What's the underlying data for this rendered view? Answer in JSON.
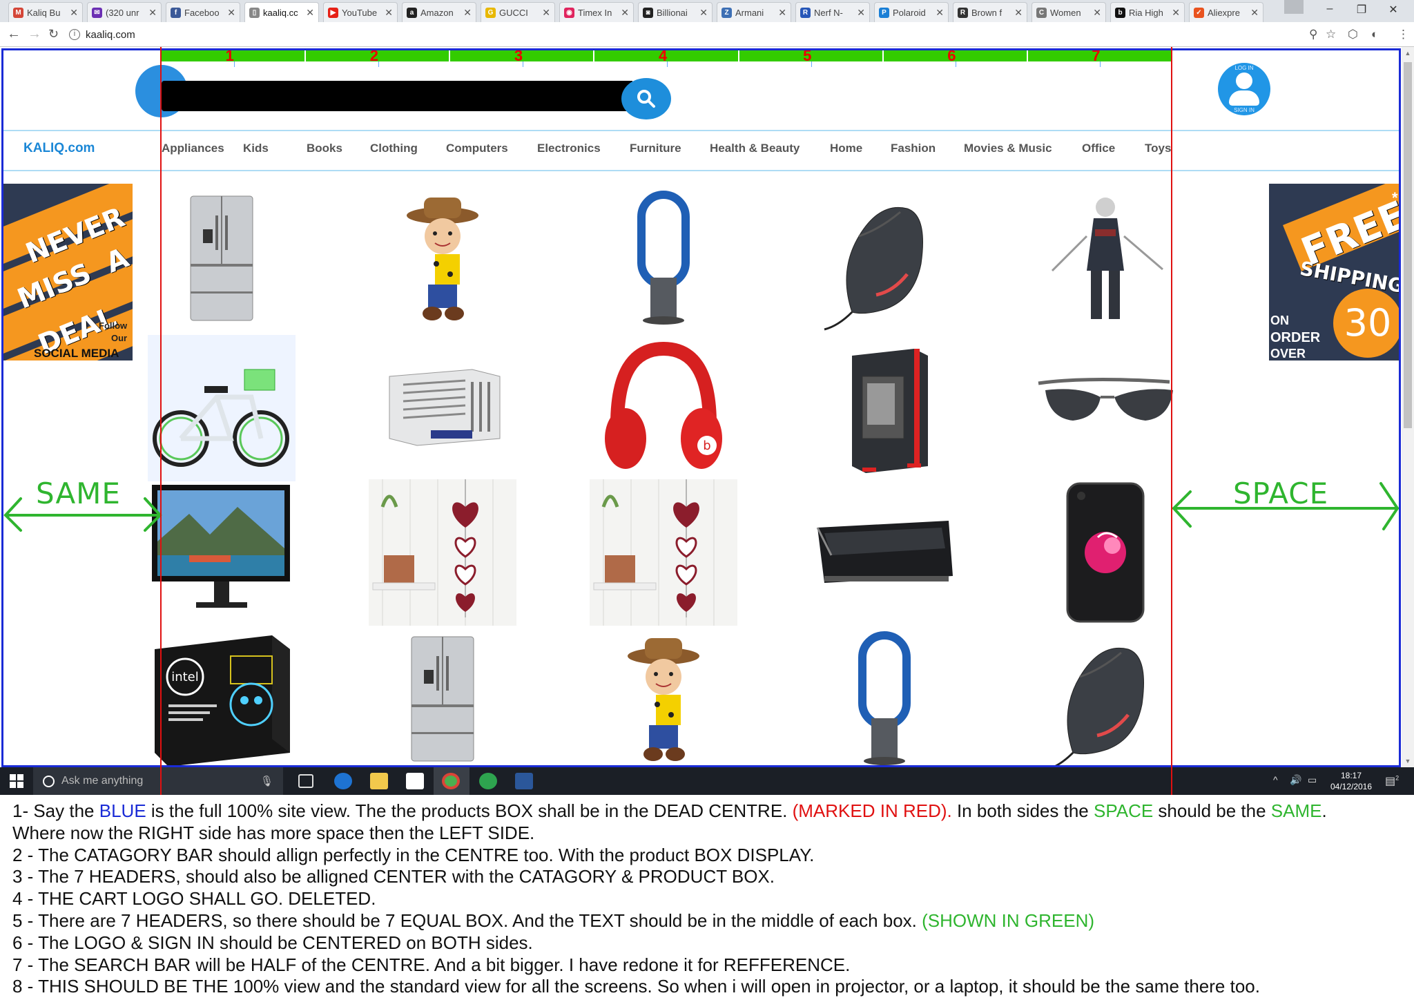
{
  "browser": {
    "tabs": [
      {
        "label": "Kaliq Bu",
        "icon": "gmail-icon",
        "color": "#d44638",
        "glyph": "M"
      },
      {
        "label": "(320 unr",
        "icon": "yahoo-mail-icon",
        "color": "#6b2fb3",
        "glyph": "✉"
      },
      {
        "label": "Faceboo",
        "icon": "facebook-icon",
        "color": "#3b5998",
        "glyph": "f"
      },
      {
        "label": "kaaliq.cc",
        "icon": "page-icon",
        "color": "#888888",
        "glyph": "▯"
      },
      {
        "label": "YouTube",
        "icon": "youtube-icon",
        "color": "#e62117",
        "glyph": "▶"
      },
      {
        "label": "Amazon",
        "icon": "amazon-icon",
        "color": "#222222",
        "glyph": "a"
      },
      {
        "label": "GUCCI",
        "icon": "gucci-icon",
        "color": "#e8b800",
        "glyph": "G"
      },
      {
        "label": "Timex In",
        "icon": "timex-icon",
        "color": "#e0245e",
        "glyph": "◉"
      },
      {
        "label": "Billionai",
        "icon": "billionaire-icon",
        "color": "#222222",
        "glyph": "◙"
      },
      {
        "label": "Armani",
        "icon": "armani-icon",
        "color": "#3d6fb4",
        "glyph": "Z"
      },
      {
        "label": "Nerf N-",
        "icon": "nerf-icon",
        "color": "#2757b8",
        "glyph": "R"
      },
      {
        "label": "Polaroid",
        "icon": "polaroid-icon",
        "color": "#1a7fd6",
        "glyph": "P"
      },
      {
        "label": "Brown f",
        "icon": "brown-icon",
        "color": "#333333",
        "glyph": "R"
      },
      {
        "label": "Women",
        "icon": "women-icon",
        "color": "#777777",
        "glyph": "C"
      },
      {
        "label": "Ria High",
        "icon": "ria-icon",
        "color": "#111111",
        "glyph": "b"
      },
      {
        "label": "Aliexpre",
        "icon": "aliexpress-icon",
        "color": "#e9531f",
        "glyph": "✓"
      }
    ],
    "active_tab": 3,
    "address": "kaaliq.com"
  },
  "site": {
    "name": "KALIQ.com",
    "signin_top": "LOG IN",
    "signin_bottom": "SIGN IN",
    "headers": [
      "1",
      "2",
      "3",
      "4",
      "5",
      "6",
      "7"
    ],
    "categories": [
      "Appliances",
      "Kids",
      "Books",
      "Clothing",
      "Computers",
      "Electronics",
      "Furniture",
      "Health & Beauty",
      "Home",
      "Fashion",
      "Movies & Music",
      "Office",
      "Toys"
    ]
  },
  "banners": {
    "left": {
      "line1": "NEVER",
      "line2": "MISS",
      "line3": "A",
      "line4": "DEAL",
      "follow": "Follow",
      "our": "Our",
      "social": "SOCIAL MEDIA"
    },
    "right": {
      "line1": "FREE",
      "line2": "SHIPPING",
      "on": "ON",
      "order": "ORDER",
      "over": "OVER",
      "amount": "30",
      "star": "*"
    }
  },
  "guides": {
    "left": "SAME",
    "right": "SPACE"
  },
  "products": [
    [
      "fridge",
      "woody-toy",
      "dyson-fan",
      "vertical-mouse",
      "assassin-figure"
    ],
    [
      "kids-bike",
      "window-ac",
      "red-headphones",
      "pc-case",
      "sunglasses"
    ],
    [
      "monitor",
      "heart-decor",
      "heart-decor",
      "split-ac",
      "iphone"
    ],
    [
      "intel-board",
      "fridge",
      "woody-toy",
      "dyson-fan",
      "vertical-mouse"
    ]
  ],
  "taskbar": {
    "search_placeholder": "Ask me anything",
    "time": "18:17",
    "date": "04/12/2016",
    "notifications": "2"
  },
  "notes": {
    "n1_a": "1- Say the ",
    "n1_b": "BLUE",
    "n1_c": " is the full 100% site view. The the products BOX shall be in the DEAD CENTRE. ",
    "n1_d": "(MARKED IN RED).",
    "n1_e": " In both sides the ",
    "n1_f": "SPACE",
    "n1_g": " should be the ",
    "n1_h": "SAME",
    "n1_i": ".",
    "n1_line2": "Where now the RIGHT side has more space then the LEFT SIDE.",
    "n2": "2 - The CATAGORY BAR should allign perfectly in the CENTRE too. With the product BOX DISPLAY.",
    "n3": "3 - The 7 HEADERS, should also be alligned CENTER with the CATAGORY & PRODUCT BOX.",
    "n4": "4 - THE CART LOGO SHALL GO. DELETED.",
    "n5_a": "5 - There are 7 HEADERS, so there should be 7 EQUAL BOX. And the TEXT should be in the middle of each box. ",
    "n5_b": "(SHOWN IN GREEN)",
    "n6": "6 - The LOGO & SIGN IN should be CENTERED on BOTH sides.",
    "n7": "7 - The SEARCH BAR will be HALF of the CENTRE. And a bit bigger. I have redone it for REFFERENCE.",
    "n8": "8 - THIS SHOULD BE THE 100% view and the standard view for all the screens. So when i will open in projector, or a laptop, it should be the same there too."
  }
}
